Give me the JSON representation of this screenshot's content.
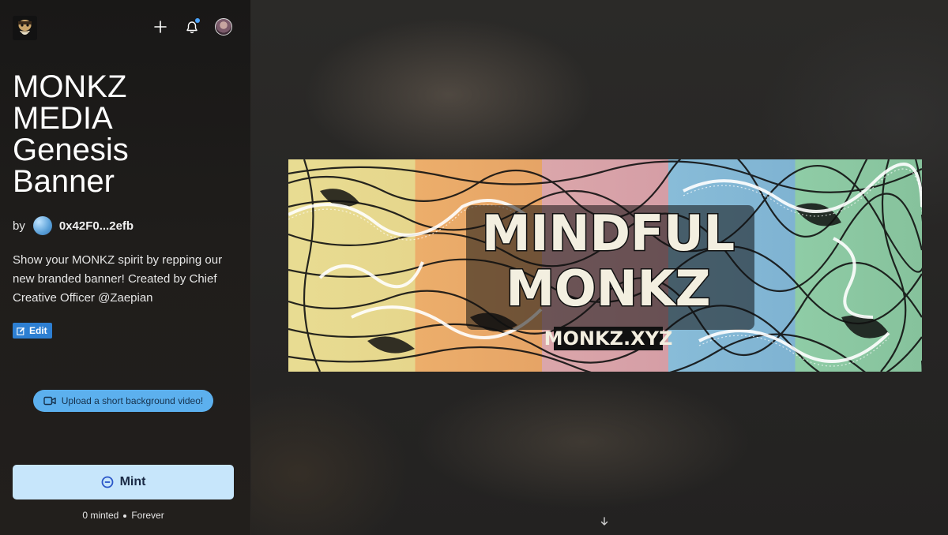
{
  "header": {
    "logo_icon": "monk-logo-icon",
    "add_icon": "plus-icon",
    "notification_icon": "bell-icon",
    "notification_dot_color": "#4aa3ff",
    "profile_icon": "user-avatar"
  },
  "collection": {
    "title_lines": [
      "MONKZ",
      "MEDIA",
      "Genesis",
      "Banner"
    ],
    "by_label": "by",
    "creator_address": "0x42F0...2efb",
    "description": "Show your MONKZ spirit by repping our new branded banner! Created by Chief Creative Officer @Zaepian",
    "edit_label": "Edit",
    "upload_label": "Upload a short background video!"
  },
  "mint": {
    "button_label": "Mint",
    "minted": "0 minted",
    "duration": "Forever"
  },
  "banner": {
    "line1": "MINDFUL",
    "line2": "MONKZ",
    "url": "MONKZ.XYZ",
    "colors": [
      "#e6d98e",
      "#e8ab6a",
      "#d9a3a8",
      "#86b9d6",
      "#8cc9a3"
    ]
  },
  "colors": {
    "accent": "#2d7fd2",
    "mint_button": "#c7e6fb",
    "upload_button": "#5cb0ee"
  }
}
